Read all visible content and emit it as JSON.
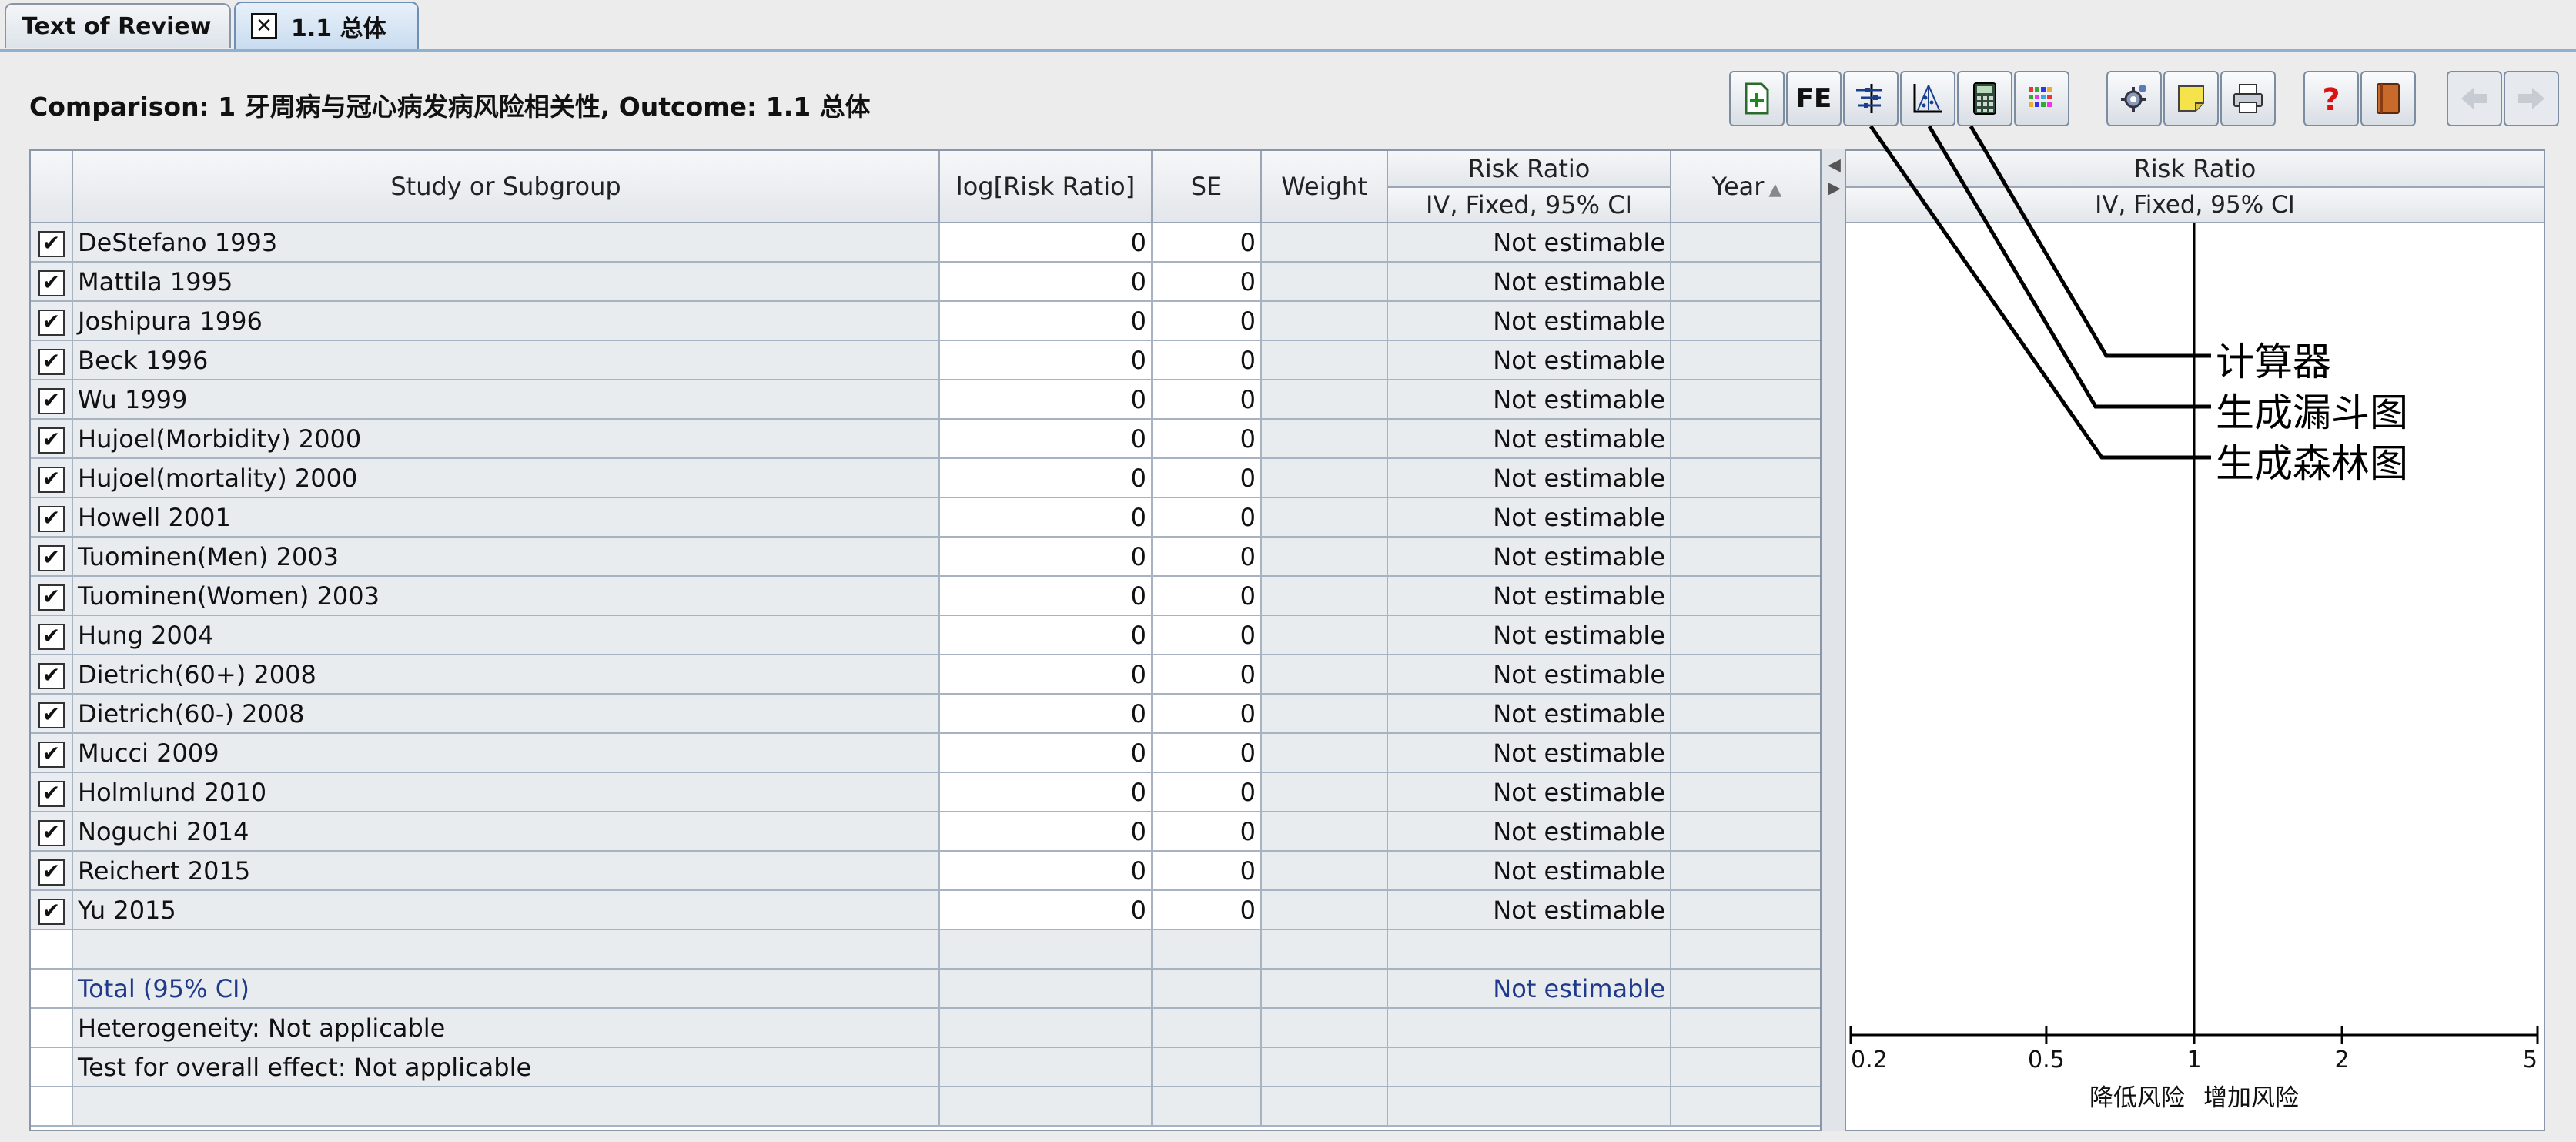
{
  "tabs": [
    {
      "label": "Text of Review"
    },
    {
      "label": "1.1 总体"
    }
  ],
  "header": {
    "comparison_text": "Comparison: 1 牙周病与冠心病发病风险相关性, Outcome: 1.1 总体"
  },
  "toolbar": {
    "fe_label": "FE",
    "icons": [
      "add-study-icon",
      "fixed-effect",
      "forest-plot-icon",
      "funnel-plot-icon",
      "calculator-icon",
      "grid-color-icon",
      "properties-icon",
      "note-icon",
      "print-icon",
      "help-icon",
      "book-icon",
      "back-arrow-icon",
      "forward-arrow-icon"
    ]
  },
  "table": {
    "headers": {
      "study": "Study or Subgroup",
      "log_rr": "log[Risk Ratio]",
      "se": "SE",
      "weight": "Weight",
      "rr_top": "Risk Ratio",
      "rr_sub": "IV, Fixed, 95% CI",
      "year": "Year"
    },
    "rows": [
      {
        "checked": "✔",
        "study": "DeStefano 1993",
        "log": "0",
        "se": "0",
        "weight": "",
        "rr": "Not estimable"
      },
      {
        "checked": "✔",
        "study": "Mattila 1995",
        "log": "0",
        "se": "0",
        "weight": "",
        "rr": "Not estimable"
      },
      {
        "checked": "✔",
        "study": "Joshipura 1996",
        "log": "0",
        "se": "0",
        "weight": "",
        "rr": "Not estimable"
      },
      {
        "checked": "✔",
        "study": "Beck 1996",
        "log": "0",
        "se": "0",
        "weight": "",
        "rr": "Not estimable"
      },
      {
        "checked": "✔",
        "study": "Wu 1999",
        "log": "0",
        "se": "0",
        "weight": "",
        "rr": "Not estimable"
      },
      {
        "checked": "✔",
        "study": "Hujoel(Morbidity) 2000",
        "log": "0",
        "se": "0",
        "weight": "",
        "rr": "Not estimable"
      },
      {
        "checked": "✔",
        "study": "Hujoel(mortality) 2000",
        "log": "0",
        "se": "0",
        "weight": "",
        "rr": "Not estimable"
      },
      {
        "checked": "✔",
        "study": "Howell 2001",
        "log": "0",
        "se": "0",
        "weight": "",
        "rr": "Not estimable"
      },
      {
        "checked": "✔",
        "study": "Tuominen(Men) 2003",
        "log": "0",
        "se": "0",
        "weight": "",
        "rr": "Not estimable"
      },
      {
        "checked": "✔",
        "study": "Tuominen(Women) 2003",
        "log": "0",
        "se": "0",
        "weight": "",
        "rr": "Not estimable"
      },
      {
        "checked": "✔",
        "study": "Hung 2004",
        "log": "0",
        "se": "0",
        "weight": "",
        "rr": "Not estimable"
      },
      {
        "checked": "✔",
        "study": "Dietrich(60+) 2008",
        "log": "0",
        "se": "0",
        "weight": "",
        "rr": "Not estimable"
      },
      {
        "checked": "✔",
        "study": "Dietrich(60-) 2008",
        "log": "0",
        "se": "0",
        "weight": "",
        "rr": "Not estimable"
      },
      {
        "checked": "✔",
        "study": "Mucci 2009",
        "log": "0",
        "se": "0",
        "weight": "",
        "rr": "Not estimable"
      },
      {
        "checked": "✔",
        "study": "Holmlund 2010",
        "log": "0",
        "se": "0",
        "weight": "",
        "rr": "Not estimable"
      },
      {
        "checked": "✔",
        "study": "Noguchi 2014",
        "log": "0",
        "se": "0",
        "weight": "",
        "rr": "Not estimable"
      },
      {
        "checked": "✔",
        "study": "Reichert 2015",
        "log": "0",
        "se": "0",
        "weight": "",
        "rr": "Not estimable"
      },
      {
        "checked": "✔",
        "study": "Yu 2015",
        "log": "0",
        "se": "0",
        "weight": "",
        "rr": "Not estimable"
      }
    ],
    "total_label": "Total (95% CI)",
    "total_value": "Not estimable",
    "heterogeneity": "Heterogeneity: Not applicable",
    "overall_effect": "Test for overall effect: Not applicable"
  },
  "forest": {
    "title": "Risk Ratio",
    "subtitle": "IV, Fixed, 95% CI",
    "axis": {
      "scale": "log",
      "ticks": [
        {
          "label": "0.2",
          "value": 0.2
        },
        {
          "label": "0.5",
          "value": 0.5
        },
        {
          "label": "1",
          "value": 1
        },
        {
          "label": "2",
          "value": 2
        },
        {
          "label": "5",
          "value": 5
        }
      ],
      "range": [
        0.2,
        5
      ],
      "reference_value": 1
    },
    "favours_left": "降低风险",
    "favours_right": "增加风险"
  },
  "annotations": {
    "calculator": "计算器",
    "funnel": "生成漏斗图",
    "forest": "生成森林图"
  },
  "colors": {
    "total_text": "#1f3a8a",
    "header_bg": "#e3e6ea",
    "grid_line": "#a7b3c1"
  }
}
